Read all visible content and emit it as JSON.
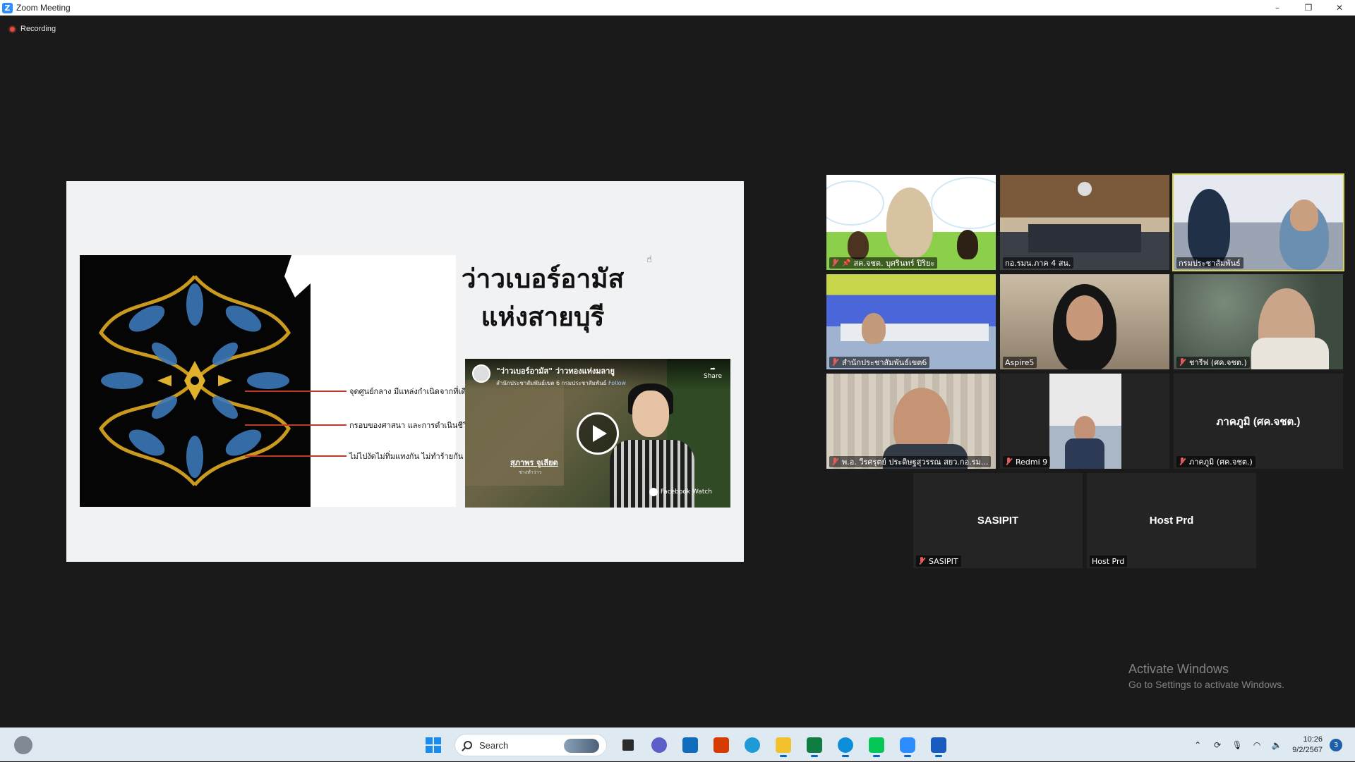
{
  "window": {
    "title": "Zoom Meeting",
    "controls": {
      "minimize": "–",
      "restore": "❐",
      "close": "✕"
    }
  },
  "recording": {
    "label": "Recording",
    "color": "#e74c3c"
  },
  "slide": {
    "title_line1": "ว่าวเบอร์อามัส",
    "title_line2": "แห่งสายบุรี",
    "bullets": [
      "จุดศูนย์กลาง มีแหล่งกำเนิดจากที่เดียวกัน",
      "กรอบของศาสนา และการดำเนินชีวิต",
      "ไม่ไปงัดไม่ทิ่มแทงกัน ไม่ทำร้ายกัน"
    ],
    "video": {
      "title": "\"ว่าวเบอร์อามัส\" ว่าวทองแห่งมลายู",
      "subtitle": "สำนักประชาสัมพันธ์เขต 6 กรมประชาสัมพันธ์",
      "follow": "Follow",
      "share": "Share",
      "caption": "สุภาพร จูเลียด",
      "caption_sub": "ช่างทำว่าว",
      "source": "Facebook Watch"
    }
  },
  "participants": [
    {
      "name": "สค.จชต. บุศรินทร์ ปิริยะ",
      "muted": true,
      "pinned": true,
      "speaking": false,
      "scene": "cartoon"
    },
    {
      "name": "กอ.รมน.ภาค 4 สน.",
      "muted": false,
      "pinned": false,
      "speaking": false,
      "scene": "room"
    },
    {
      "name": "กรมประชาสัมพันธ์",
      "muted": false,
      "pinned": false,
      "speaking": true,
      "scene": "office"
    },
    {
      "name": "สำนักประชาสัมพันธ์เขต6",
      "muted": true,
      "pinned": false,
      "speaking": false,
      "scene": "blue"
    },
    {
      "name": "Aspire5",
      "muted": false,
      "pinned": false,
      "speaking": false,
      "scene": "hotel"
    },
    {
      "name": "ชารีฟ (ศค.จชต.)",
      "muted": true,
      "pinned": false,
      "speaking": false,
      "scene": "blur"
    },
    {
      "name": "พ.อ. วีรศรุตย์ ประดิษฐสุวรรณ สยว.กอ.รม...",
      "muted": true,
      "pinned": false,
      "speaking": false,
      "scene": "curtain"
    },
    {
      "name": "Redmi 9",
      "muted": true,
      "pinned": false,
      "speaking": false,
      "scene": "portrait"
    },
    {
      "name": "ภาคภูมิ (ศค.จชต.)",
      "display": "ภาคภูมิ (ศค.จชต.)",
      "muted": true,
      "pinned": false,
      "speaking": false,
      "scene": "none"
    },
    {
      "name": "SASIPIT",
      "display": "SASIPIT",
      "muted": true,
      "pinned": false,
      "speaking": false,
      "scene": "none"
    },
    {
      "name": "Host Prd",
      "display": "Host Prd",
      "muted": false,
      "pinned": false,
      "speaking": false,
      "scene": "none"
    }
  ],
  "watermark": {
    "line1": "Activate Windows",
    "line2": "Go to Settings to activate Windows."
  },
  "taskbar": {
    "search_placeholder": "Search",
    "apps": [
      "task-view",
      "teams-chat",
      "mail",
      "office",
      "browser-globe",
      "file-explorer",
      "excel",
      "edge",
      "line",
      "zoom",
      "word"
    ],
    "time": "10:26",
    "date": "9/2/2567",
    "notifications": "3"
  },
  "colors": {
    "accent": "#2d8cff",
    "speaker_outline": "#d8d34c",
    "muted": "#e25a5a"
  }
}
